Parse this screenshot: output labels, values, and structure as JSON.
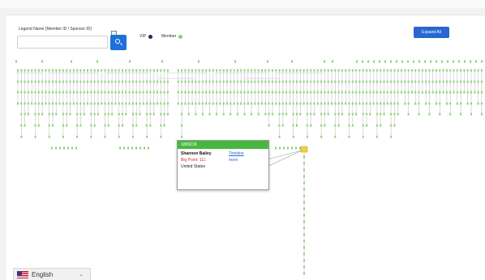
{
  "search": {
    "label": "Legend Name (Member ID / Sponsor ID)",
    "value": "",
    "placeholder": ""
  },
  "legend": [
    {
      "label": "VIP",
      "color": "#1a2a5c"
    },
    {
      "label": "Member",
      "color": "#7bd86b"
    }
  ],
  "toolbar": {
    "expand_label": "Expand All"
  },
  "tooltip": {
    "id": "1899218",
    "name": "Shannon Bailey",
    "big_points": "Big Point: 111",
    "country": "United States",
    "link_1": "Timeline",
    "link_2": "more"
  },
  "language": {
    "label": "English",
    "icon": "uk-flag-icon"
  },
  "colors": {
    "node_stroke": "#5cb85c",
    "line": "#c4c4c4",
    "accent": "#2a66d1",
    "highlight": "#f0d040"
  }
}
